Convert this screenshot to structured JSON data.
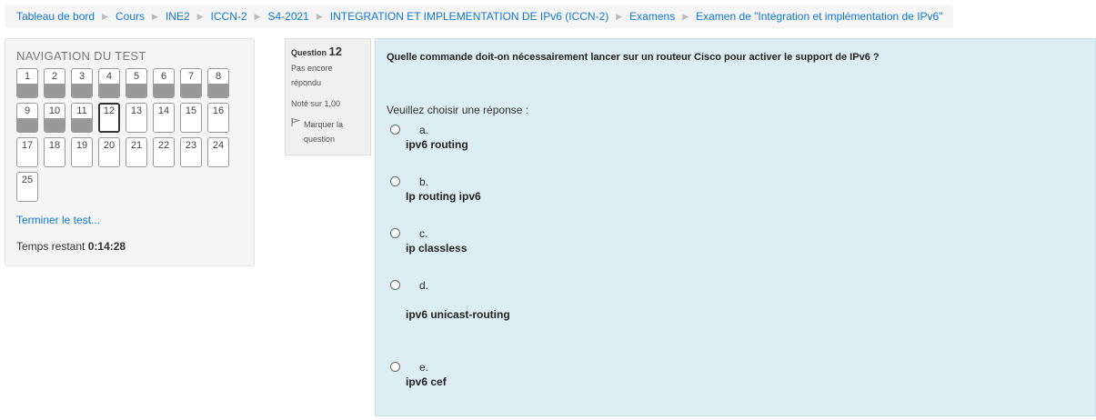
{
  "breadcrumb": [
    "Tableau de bord",
    "Cours",
    "INE2",
    "ICCN-2",
    "S4-2021",
    "INTEGRATION ET IMPLEMENTATION DE IPv6 (ICCN-2)",
    "Examens",
    "Examen de \"Intégration et implémentation de IPv6\""
  ],
  "nav": {
    "title": "NAVIGATION DU TEST",
    "questions": [
      {
        "label": "1",
        "state": "answered"
      },
      {
        "label": "2",
        "state": "answered"
      },
      {
        "label": "3",
        "state": "answered"
      },
      {
        "label": "4",
        "state": "answered"
      },
      {
        "label": "5",
        "state": "answered"
      },
      {
        "label": "6",
        "state": "answered"
      },
      {
        "label": "7",
        "state": "answered"
      },
      {
        "label": "8",
        "state": "answered"
      },
      {
        "label": "9",
        "state": "answered"
      },
      {
        "label": "10",
        "state": "answered"
      },
      {
        "label": "11",
        "state": "answered"
      },
      {
        "label": "12",
        "state": "current"
      },
      {
        "label": "13",
        "state": "unanswered"
      },
      {
        "label": "14",
        "state": "unanswered"
      },
      {
        "label": "15",
        "state": "unanswered"
      },
      {
        "label": "16",
        "state": "unanswered"
      },
      {
        "label": "17",
        "state": "unanswered"
      },
      {
        "label": "18",
        "state": "unanswered"
      },
      {
        "label": "19",
        "state": "unanswered"
      },
      {
        "label": "20",
        "state": "unanswered"
      },
      {
        "label": "21",
        "state": "unanswered"
      },
      {
        "label": "22",
        "state": "unanswered"
      },
      {
        "label": "23",
        "state": "unanswered"
      },
      {
        "label": "24",
        "state": "unanswered"
      },
      {
        "label": "25",
        "state": "unanswered"
      }
    ],
    "finish_label": "Terminer le test...",
    "time_label": "Temps restant",
    "time_value": "0:14:28"
  },
  "question_info": {
    "label": "Question",
    "number": "12",
    "state": "Pas encore répondu",
    "grade": "Noté sur 1,00",
    "flag_label": "Marquer la question",
    "flag_icon": "flag-icon"
  },
  "question": {
    "text": "Quelle commande doit-on nécessairement lancer sur un routeur Cisco pour activer le support de IPv6 ?",
    "prompt": "Veuillez choisir une réponse :",
    "options": [
      {
        "letter": "a.",
        "text": "ipv6 routing"
      },
      {
        "letter": "b.",
        "text": "Ip routing ipv6"
      },
      {
        "letter": "c.",
        "text": "ip classless"
      },
      {
        "letter": "d.",
        "text": "ipv6 unicast-routing"
      },
      {
        "letter": "e.",
        "text": "ipv6 cef"
      }
    ]
  },
  "colors": {
    "link": "#1177d1",
    "content_bg": "#dcedf4",
    "answered": "#999999"
  }
}
